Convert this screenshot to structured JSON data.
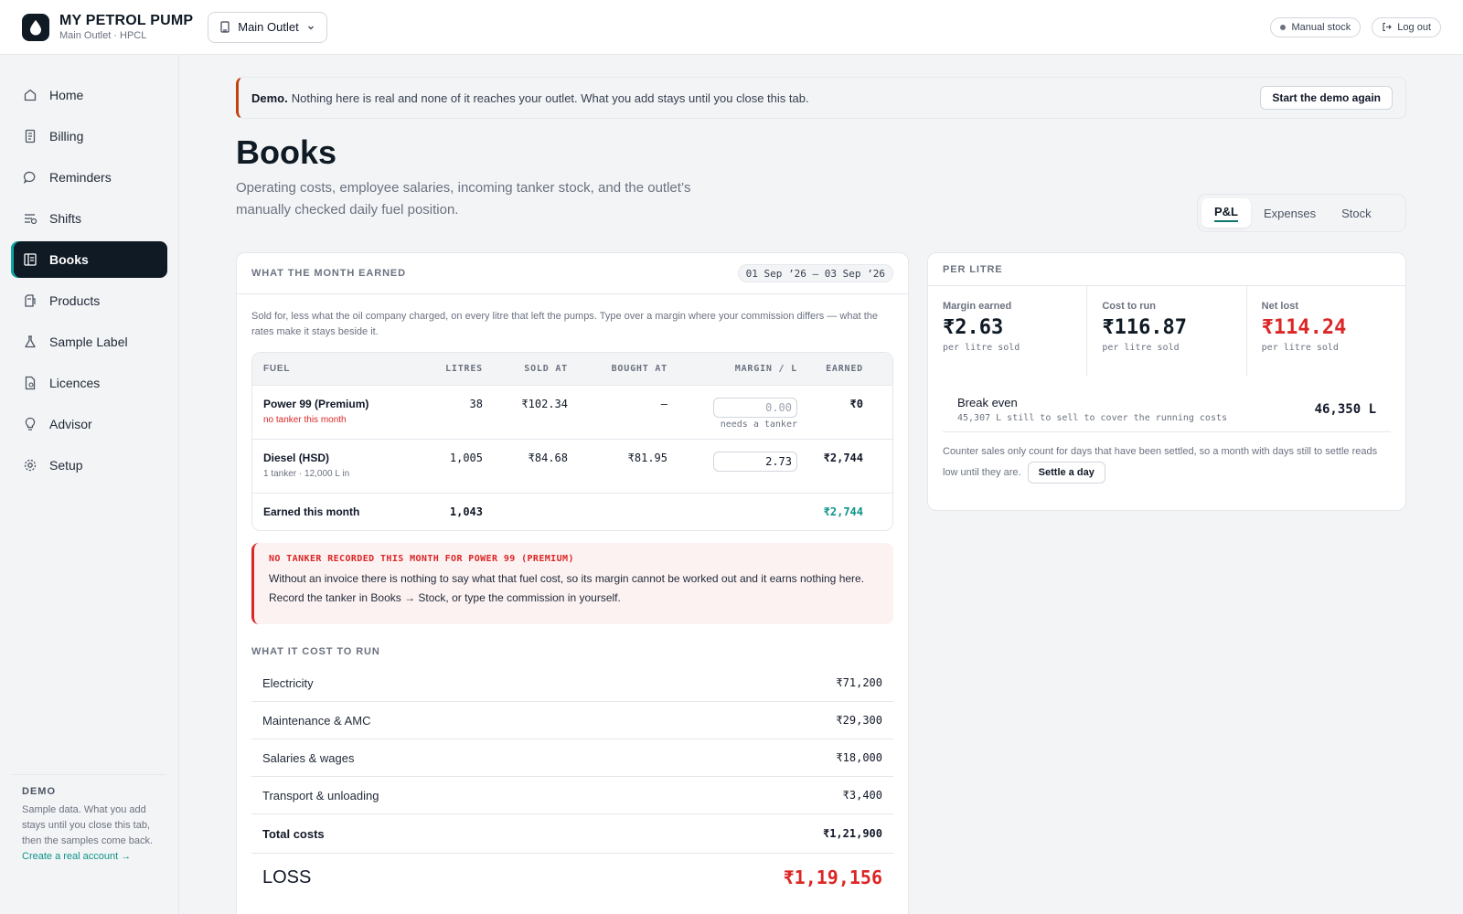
{
  "app": {
    "name": "MY PETROL PUMP",
    "subtitle": "Main Outlet · HPCL",
    "outlet_selector": "Main Outlet",
    "manual_stock_label": "Manual stock",
    "logout_label": "Log out"
  },
  "sidebar": {
    "items": [
      {
        "label": "Home",
        "icon": "home-icon"
      },
      {
        "label": "Billing",
        "icon": "receipt-icon"
      },
      {
        "label": "Reminders",
        "icon": "chat-bubble-icon"
      },
      {
        "label": "Shifts",
        "icon": "shifts-icon"
      },
      {
        "label": "Books",
        "icon": "ledger-icon",
        "active": true
      },
      {
        "label": "Products",
        "icon": "fuel-can-icon"
      },
      {
        "label": "Sample Label",
        "icon": "flask-icon"
      },
      {
        "label": "Licences",
        "icon": "document-icon"
      },
      {
        "label": "Advisor",
        "icon": "lightbulb-icon"
      },
      {
        "label": "Setup",
        "icon": "gear-icon"
      }
    ],
    "demo": {
      "title": "DEMO",
      "text": "Sample data. What you add stays until you close this tab, then the samples come back.",
      "link": "Create a real account →"
    }
  },
  "banner": {
    "strong": "Demo.",
    "text": "Nothing here is real and none of it reaches your outlet. What you add stays until you close this tab.",
    "button": "Start the demo again"
  },
  "page": {
    "title": "Books",
    "description": "Operating costs, employee salaries, incoming tanker stock, and the outlet’s manually checked daily fuel position.",
    "tabs": [
      "P&L",
      "Expenses",
      "Stock"
    ],
    "active_tab": "P&L"
  },
  "earned": {
    "title": "WHAT THE MONTH EARNED",
    "date_range": "01 Sep ’26 – 03 Sep ’26",
    "note": "Sold for, less what the oil company charged, on every litre that left the pumps. Type over a margin where your commission differs — what the rates make it stays beside it.",
    "columns": [
      "FUEL",
      "LITRES",
      "SOLD AT",
      "BOUGHT AT",
      "MARGIN / L",
      "EARNED"
    ],
    "rows": [
      {
        "fuel": "Power 99 (Premium)",
        "sub": "no tanker this month",
        "litres": "38",
        "sold_at": "₹102.34",
        "bought_at": "—",
        "margin_placeholder": "0.00",
        "margin_hint": "needs a tanker",
        "earned": "₹0"
      },
      {
        "fuel": "Diesel (HSD)",
        "sub": "1 tanker · 12,000 L in",
        "litres": "1,005",
        "sold_at": "₹84.68",
        "bought_at": "₹81.95",
        "margin_value": "2.73",
        "earned": "₹2,744"
      }
    ],
    "total": {
      "label": "Earned this month",
      "litres": "1,043",
      "earned": "₹2,744"
    },
    "alert": {
      "title": "NO TANKER RECORDED THIS MONTH FOR POWER 99 (PREMIUM)",
      "text": "Without an invoice there is nothing to say what that fuel cost, so its margin cannot be worked out and it earns nothing here. Record the tanker in Books → Stock, or type the commission in yourself."
    }
  },
  "costs": {
    "title": "WHAT IT COST TO RUN",
    "items": [
      {
        "label": "Electricity",
        "value": "₹71,200"
      },
      {
        "label": "Maintenance & AMC",
        "value": "₹29,300"
      },
      {
        "label": "Salaries & wages",
        "value": "₹18,000"
      },
      {
        "label": "Transport & unloading",
        "value": "₹3,400"
      }
    ],
    "total_label": "Total costs",
    "total_value": "₹1,21,900",
    "loss_label": "LOSS",
    "loss_value": "₹1,19,156"
  },
  "per_litre": {
    "title": "PER LITRE",
    "stats": [
      {
        "label": "Margin earned",
        "value": "₹2.63",
        "sub": "per litre sold"
      },
      {
        "label": "Cost to run",
        "value": "₹116.87",
        "sub": "per litre sold"
      },
      {
        "label": "Net lost",
        "value": "₹114.24",
        "sub": "per litre sold"
      }
    ],
    "break_even": {
      "label": "Break even",
      "sub": "45,307 L still to sell to cover the running costs",
      "value": "46,350 L"
    },
    "footnote": "Counter sales only count for days that have been settled, so a month with days still to settle reads low until they are.",
    "settle_button": "Settle a day"
  },
  "colors": {
    "navy": "#0f1a24",
    "accent_teal": "#0d9488",
    "loss_red": "#dc2626",
    "banner_accent": "#c2410c"
  }
}
